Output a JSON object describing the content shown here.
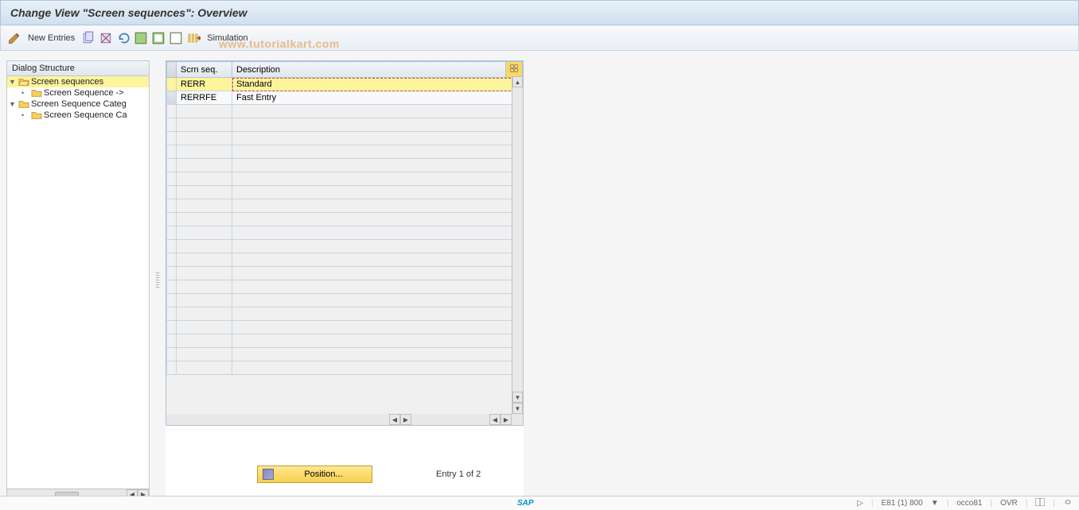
{
  "title": "Change View \"Screen sequences\": Overview",
  "toolbar": {
    "new_entries_label": "New Entries",
    "simulation_label": "Simulation"
  },
  "dialog_structure": {
    "header": "Dialog Structure",
    "items": [
      {
        "label": "Screen sequences",
        "level": 0,
        "open": true,
        "selected": true,
        "expandable": true
      },
      {
        "label": "Screen Sequence ->",
        "level": 1,
        "open": false,
        "selected": false,
        "expandable": false
      },
      {
        "label": "Screen Sequence Categ",
        "level": 0,
        "open": true,
        "selected": false,
        "expandable": true
      },
      {
        "label": "Screen Sequence Ca",
        "level": 1,
        "open": false,
        "selected": false,
        "expandable": false
      }
    ]
  },
  "table": {
    "columns": {
      "scrn_seq": "Scrn seq.",
      "description": "Description"
    },
    "rows": [
      {
        "scrn_seq": "RERR",
        "description": "Standard",
        "selected": true
      },
      {
        "scrn_seq": "RERRFE",
        "description": "Fast Entry",
        "selected": false
      }
    ],
    "empty_row_count": 20
  },
  "footer": {
    "position_label": "Position...",
    "entry_text": "Entry 1 of 2"
  },
  "status": {
    "system": "E81 (1) 800",
    "server": "occo81",
    "mode": "OVR"
  },
  "watermark": "www.tutorialkart.com",
  "sap_logo": "SAP"
}
